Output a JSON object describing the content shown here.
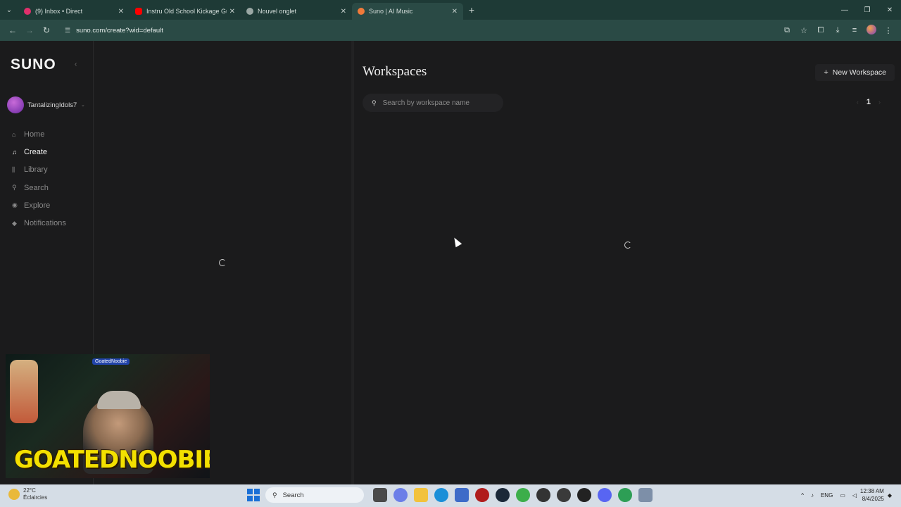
{
  "browser": {
    "tabs": [
      {
        "title": "(9) Inbox • Direct",
        "color": "#e1306c",
        "active": false
      },
      {
        "title": "Instru Old School Kickage Guit",
        "color": "#ff0000",
        "active": false
      },
      {
        "title": "Nouvel onglet",
        "color": "#9aa7a4",
        "active": false
      },
      {
        "title": "Suno | AI Music",
        "color": "#f07a3a",
        "active": true
      }
    ],
    "url": "suno.com/create?wid=default"
  },
  "sidebar": {
    "logo": "SUNO",
    "username": "TantalizingIdols7",
    "nav": [
      {
        "label": "Home",
        "icon": "home-icon",
        "glyph": "⌂",
        "active": false
      },
      {
        "label": "Create",
        "icon": "music-note-icon",
        "glyph": "♫",
        "active": true
      },
      {
        "label": "Library",
        "icon": "library-icon",
        "glyph": "⫼",
        "active": false
      },
      {
        "label": "Search",
        "icon": "search-icon",
        "glyph": "⚲",
        "active": false
      },
      {
        "label": "Explore",
        "icon": "compass-icon",
        "glyph": "◉",
        "active": false
      },
      {
        "label": "Notifications",
        "icon": "bell-icon",
        "glyph": "◆",
        "active": false
      }
    ]
  },
  "workspaces": {
    "title": "Workspaces",
    "new_button": "New Workspace",
    "search_placeholder": "Search by workspace name",
    "current_page": "1"
  },
  "webcam": {
    "tag": "GoatedNoobie",
    "brand": "GOATEDNOOBIE"
  },
  "taskbar": {
    "weather_temp": "22°C",
    "weather_desc": "Éclaircies",
    "search_label": "Search",
    "language": "ENG",
    "time": "12:38 AM",
    "date": "8/4/2025"
  }
}
